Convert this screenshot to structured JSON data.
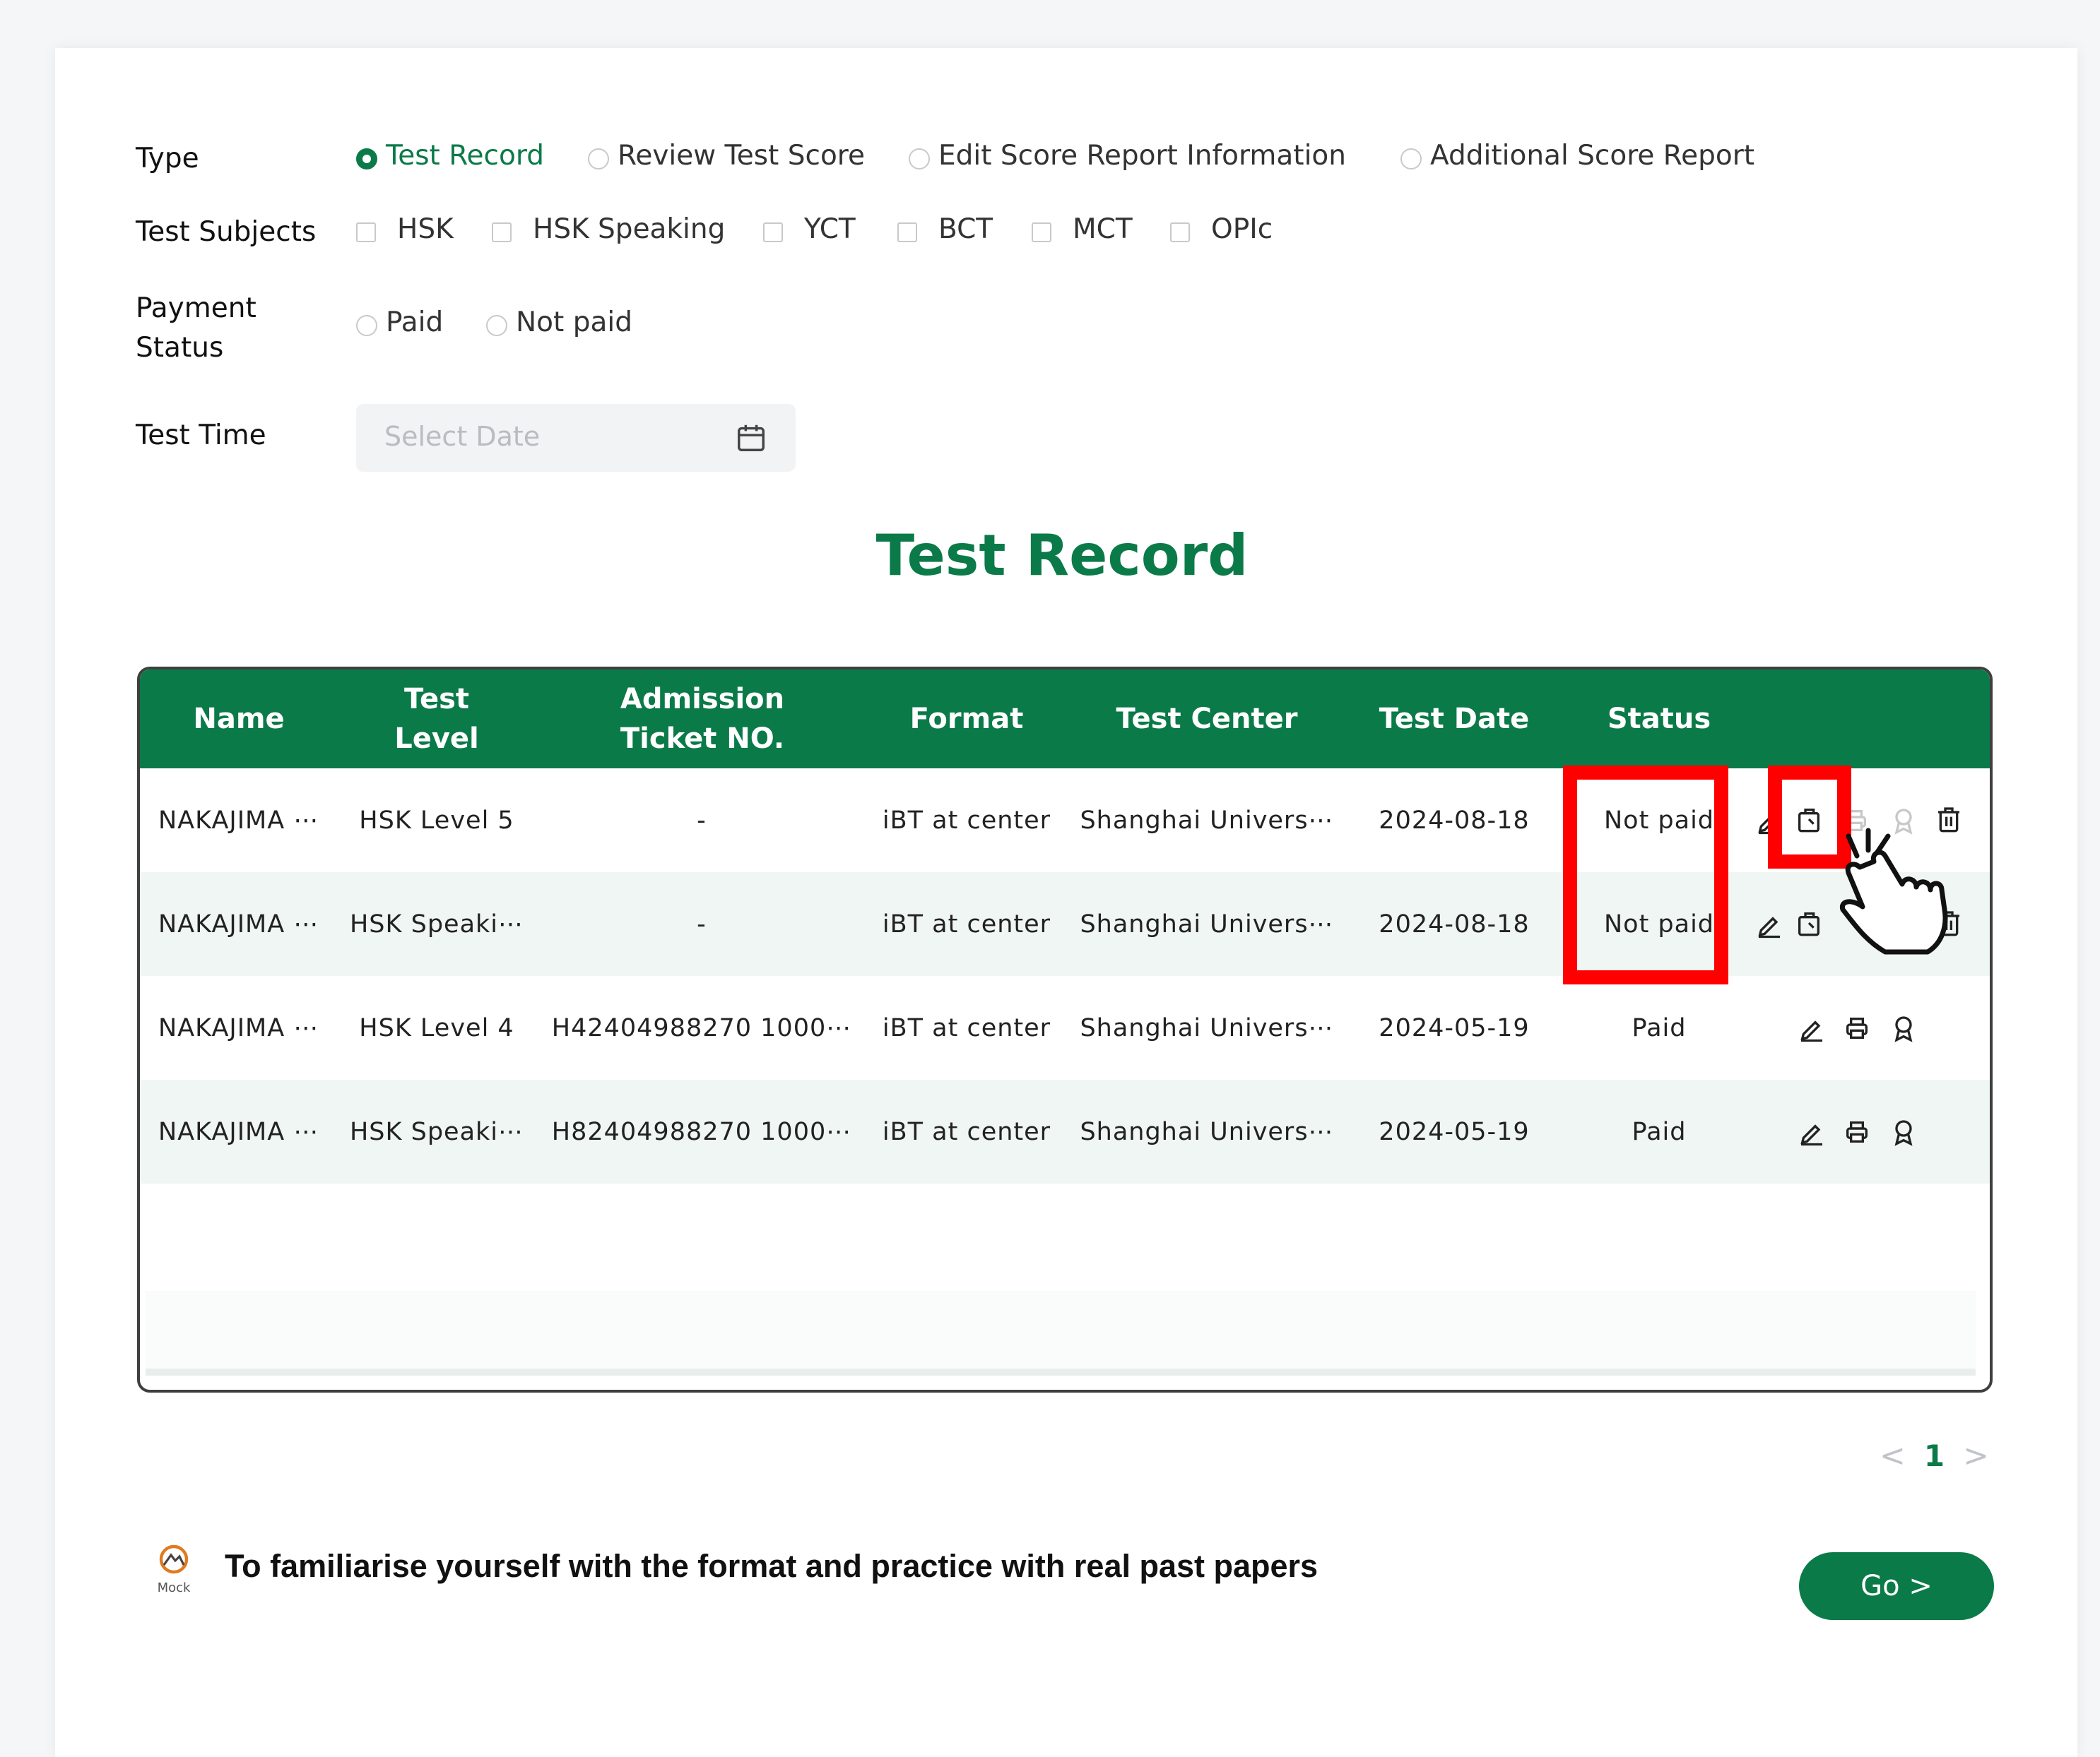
{
  "filters": {
    "type_label": "Type",
    "type_options": [
      "Test Record",
      "Review Test Score",
      "Edit Score Report Information",
      "Additional Score Report"
    ],
    "type_selected": "Test Record",
    "subjects_label": "Test Subjects",
    "subjects": [
      "HSK",
      "HSK Speaking",
      "YCT",
      "BCT",
      "MCT",
      "OPIc"
    ],
    "payment_label_line1": "Payment",
    "payment_label_line2": "Status",
    "payment_options": [
      "Paid",
      "Not paid"
    ],
    "time_label": "Test Time",
    "date_placeholder": "Select Date"
  },
  "section_title": "Test Record",
  "table": {
    "headers": [
      "Name",
      "Test Level",
      "Admission Ticket NO.",
      "Format",
      "Test Center",
      "Test Date",
      "Status"
    ],
    "rows": [
      {
        "name": "NAKAJIMA ⋯",
        "level": "HSK Level 5",
        "ticket": "-",
        "format": "iBT at center",
        "center": "Shanghai Univers⋯",
        "date": "2024-08-18",
        "status": "Not paid"
      },
      {
        "name": "NAKAJIMA ⋯",
        "level": "HSK Speaki⋯",
        "ticket": "-",
        "format": "iBT at center",
        "center": "Shanghai Univers⋯",
        "date": "2024-08-18",
        "status": "Not paid"
      },
      {
        "name": "NAKAJIMA ⋯",
        "level": "HSK Level 4",
        "ticket": "H42404988270 1000⋯",
        "format": "iBT at center",
        "center": "Shanghai Univers⋯",
        "date": "2024-05-19",
        "status": "Paid"
      },
      {
        "name": "NAKAJIMA ⋯",
        "level": "HSK Speaki⋯",
        "ticket": "H82404988270 1000⋯",
        "format": "iBT at center",
        "center": "Shanghai Univers⋯",
        "date": "2024-05-19",
        "status": "Paid"
      }
    ],
    "action_icons_unpaid": [
      "edit-icon",
      "payment-icon",
      "print-icon",
      "certificate-icon",
      "delete-icon"
    ],
    "action_icons_paid": [
      "edit-icon",
      "print-icon",
      "certificate-icon"
    ]
  },
  "pagination": {
    "prev": "<",
    "current": "1",
    "next": ">"
  },
  "promo": {
    "logo_text": "Mock",
    "text": "To familiarise yourself with the format and practice with real past papers",
    "button": "Go >"
  },
  "colors": {
    "brand": "#0b7a49",
    "highlight": "#ff0000"
  }
}
